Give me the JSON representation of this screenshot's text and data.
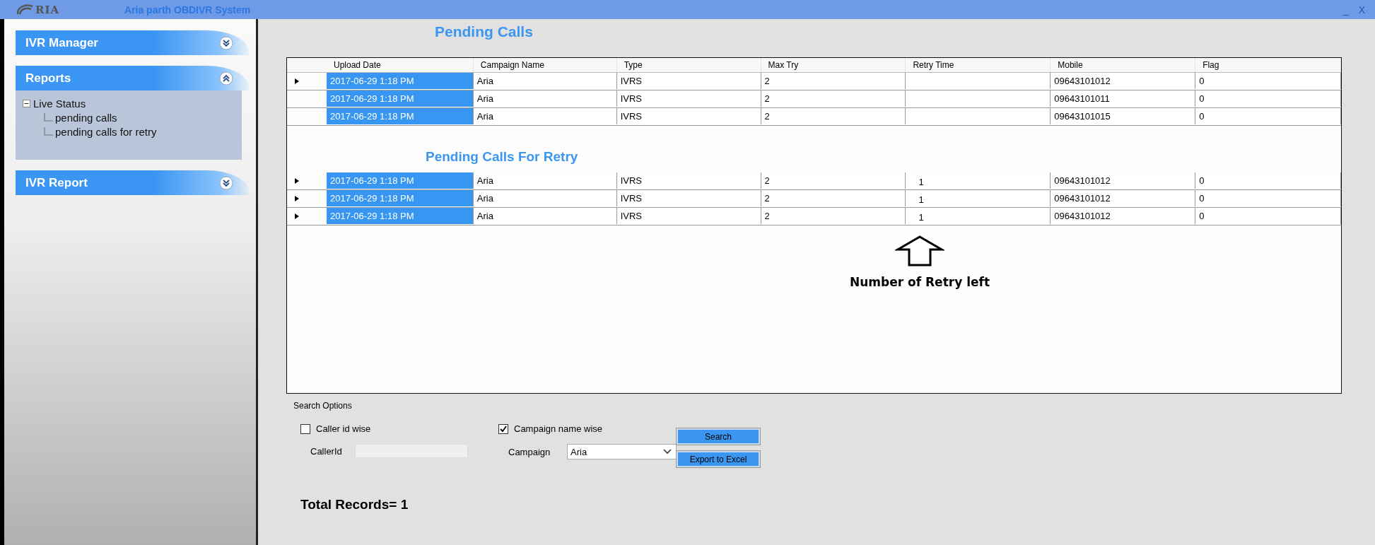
{
  "window": {
    "logo": "RIA",
    "title": "Aria parth OBDIVR System",
    "controls": [
      "_",
      "X"
    ]
  },
  "sidebar": {
    "sections": [
      {
        "title": "IVR Manager",
        "expanded": false
      },
      {
        "title": "Reports",
        "expanded": true,
        "tree": [
          {
            "label": "Live Status",
            "expanded": true,
            "children": [
              {
                "label": "pending calls"
              },
              {
                "label": "pending calls for retry"
              }
            ]
          }
        ]
      },
      {
        "title": "IVR Report",
        "expanded": false
      }
    ]
  },
  "pending_calls": {
    "title": "Pending Calls",
    "columns": [
      "Upload Date",
      "Campaign Name",
      "Type",
      "Max Try",
      "Retry Time",
      "Mobile",
      "Flag"
    ],
    "rows": [
      {
        "current": true,
        "selected": true,
        "cells": [
          "2017-06-29 1:18 PM",
          "Aria",
          "IVRS",
          "2",
          "",
          "09643101012",
          "0"
        ]
      },
      {
        "current": false,
        "selected": true,
        "cells": [
          "2017-06-29 1:18 PM",
          "Aria",
          "IVRS",
          "2",
          "",
          "09643101011",
          "0"
        ]
      },
      {
        "current": false,
        "selected": true,
        "cells": [
          "2017-06-29 1:18 PM",
          "Aria",
          "IVRS",
          "2",
          "",
          "09643101015",
          "0"
        ]
      }
    ]
  },
  "pending_calls_for_retry": {
    "title": "Pending Calls For Retry",
    "rows": [
      {
        "current": true,
        "selected": true,
        "cells": [
          "2017-06-29 1:18 PM",
          "Aria",
          "IVRS",
          "2",
          "1",
          "09643101012",
          "0"
        ]
      },
      {
        "current": true,
        "selected": true,
        "cells": [
          "2017-06-29 1:18 PM",
          "Aria",
          "IVRS",
          "2",
          "1",
          "09643101012",
          "0"
        ]
      },
      {
        "current": true,
        "selected": true,
        "cells": [
          "2017-06-29 1:18 PM",
          "Aria",
          "IVRS",
          "2",
          "1",
          "09643101012",
          "0"
        ]
      }
    ]
  },
  "annotation": {
    "text": "Number of Retry left"
  },
  "search_options": {
    "title": "Search Options",
    "options": [
      {
        "label": "Caller id wise",
        "checked": false,
        "field_label": "CallerId",
        "kind": "text",
        "disabled": true
      },
      {
        "label": "Campaign name wise",
        "checked": true,
        "field_label": "Campaign",
        "kind": "dropdown",
        "value": "Aria"
      }
    ],
    "buttons": [
      "Search",
      "Export to Excel"
    ]
  },
  "total_records": "Total Records= 1"
}
